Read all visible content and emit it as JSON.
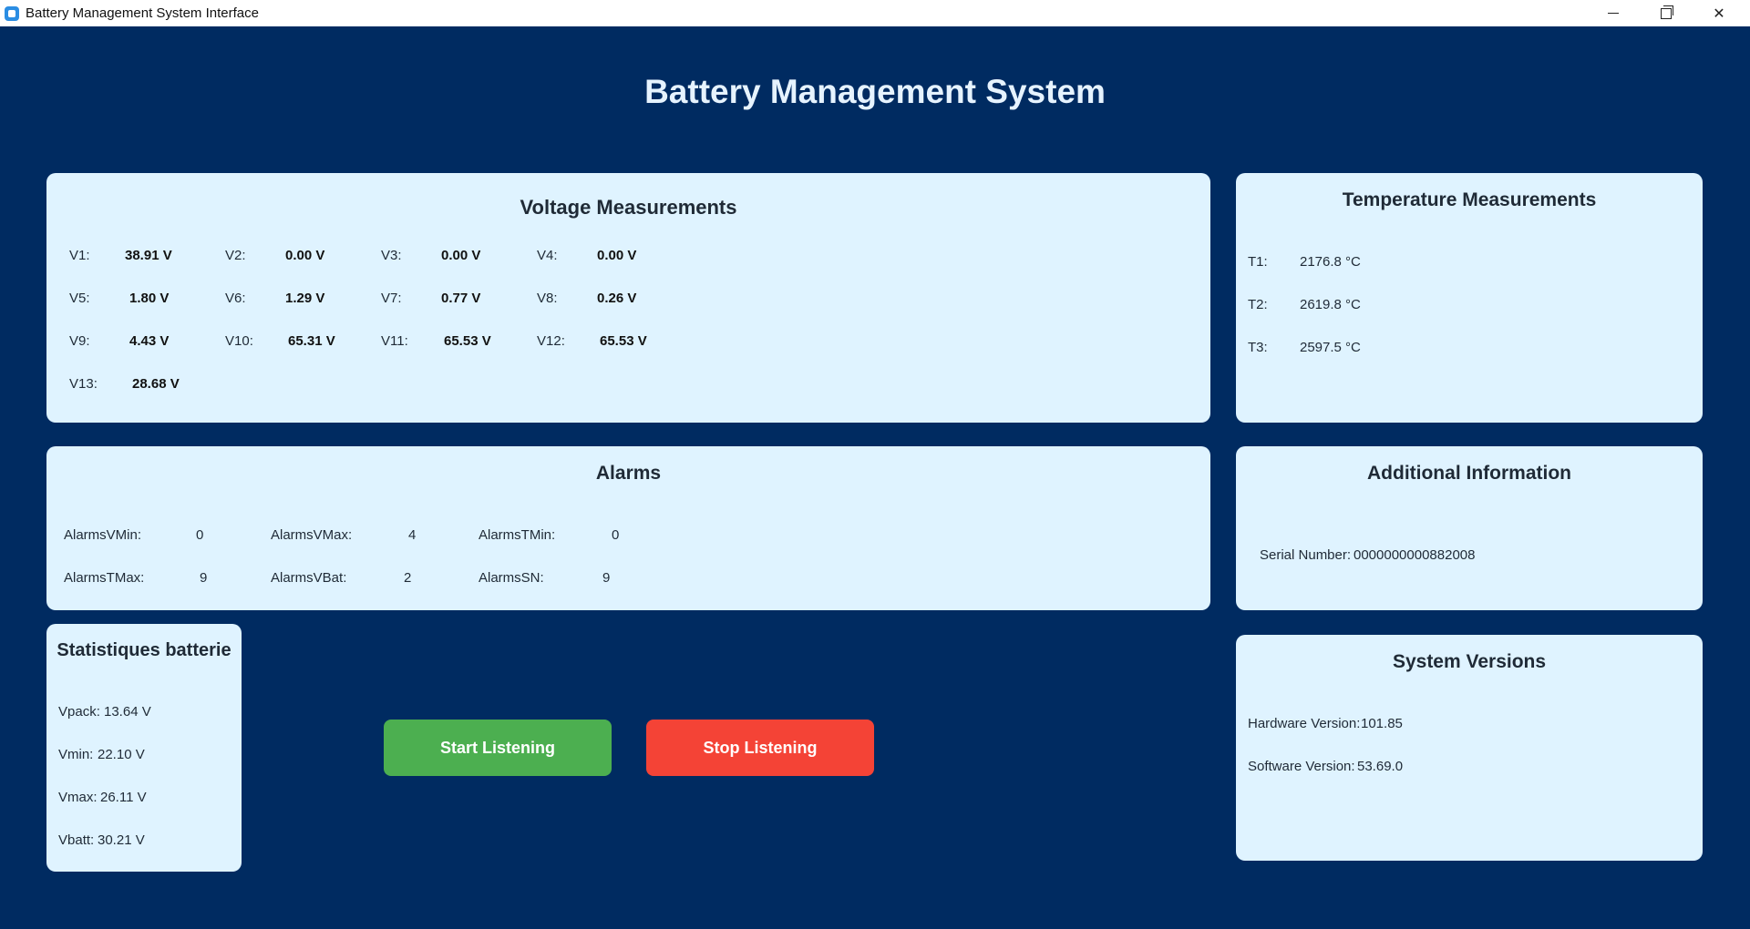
{
  "window": {
    "title": "Battery Management System Interface"
  },
  "header": {
    "title": "Battery Management System"
  },
  "voltage": {
    "title": "Voltage Measurements",
    "items": [
      {
        "label": "V1:",
        "value": "38.91 V"
      },
      {
        "label": "V2:",
        "value": "0.00 V"
      },
      {
        "label": "V3:",
        "value": "0.00 V"
      },
      {
        "label": "V4:",
        "value": "0.00 V"
      },
      {
        "label": "V5:",
        "value": "1.80 V"
      },
      {
        "label": "V6:",
        "value": "1.29 V"
      },
      {
        "label": "V7:",
        "value": "0.77 V"
      },
      {
        "label": "V8:",
        "value": "0.26 V"
      },
      {
        "label": "V9:",
        "value": "4.43 V"
      },
      {
        "label": "V10:",
        "value": "65.31 V"
      },
      {
        "label": "V11:",
        "value": "65.53 V"
      },
      {
        "label": "V12:",
        "value": "65.53 V"
      },
      {
        "label": "V13:",
        "value": "28.68 V"
      }
    ]
  },
  "temperature": {
    "title": "Temperature Measurements",
    "items": [
      {
        "label": "T1:",
        "value": "2176.8 °C"
      },
      {
        "label": "T2:",
        "value": "2619.8 °C"
      },
      {
        "label": "T3:",
        "value": "2597.5 °C"
      }
    ]
  },
  "alarms": {
    "title": "Alarms",
    "items": [
      {
        "label": "AlarmsVMin:",
        "value": "0"
      },
      {
        "label": "AlarmsVMax:",
        "value": "4"
      },
      {
        "label": "AlarmsTMin:",
        "value": "0"
      },
      {
        "label": "AlarmsTMax:",
        "value": "9"
      },
      {
        "label": "AlarmsVBat:",
        "value": "2"
      },
      {
        "label": "AlarmsSN:",
        "value": "9"
      }
    ]
  },
  "additional": {
    "title": "Additional Information",
    "serial_label": "Serial Number:",
    "serial_value": "0000000000882008"
  },
  "stats": {
    "title": "Statistiques batterie",
    "items": [
      {
        "label": "Vpack:",
        "value": "13.64 V"
      },
      {
        "label": "Vmin:",
        "value": "22.10 V"
      },
      {
        "label": "Vmax:",
        "value": "26.11 V"
      },
      {
        "label": "Vbatt:",
        "value": "30.21 V"
      }
    ]
  },
  "versions": {
    "title": "System Versions",
    "hardware_label": "Hardware Version:",
    "hardware_value": "101.85",
    "software_label": "Software Version:",
    "software_value": "53.69.0"
  },
  "controls": {
    "start_label": "Start Listening",
    "stop_label": "Stop Listening"
  },
  "colors": {
    "background": "#002b61",
    "card": "#dff3ff",
    "start": "#4caf50",
    "stop": "#f44336"
  }
}
